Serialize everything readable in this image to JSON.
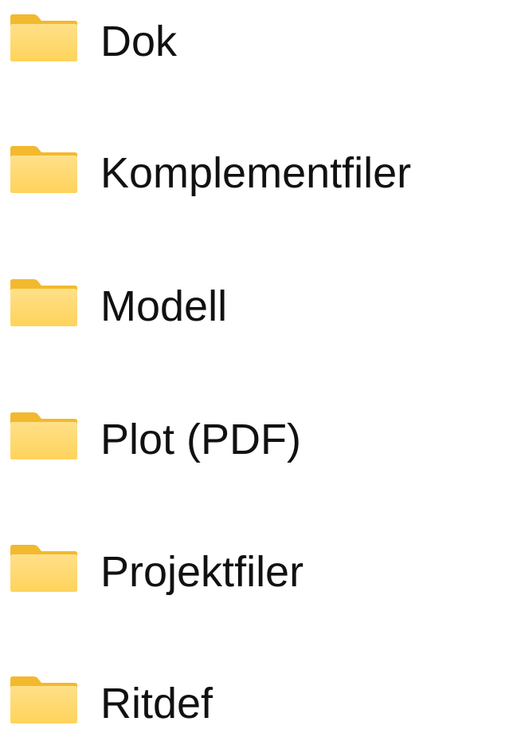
{
  "folder_list": {
    "items": [
      {
        "label": "Dok",
        "icon": "folder-icon"
      },
      {
        "label": "Komplementfiler",
        "icon": "folder-icon"
      },
      {
        "label": "Modell",
        "icon": "folder-icon"
      },
      {
        "label": "Plot (PDF)",
        "icon": "folder-icon"
      },
      {
        "label": "Projektfiler",
        "icon": "folder-icon"
      },
      {
        "label": "Ritdef",
        "icon": "folder-icon"
      }
    ]
  },
  "colors": {
    "folder_back": "#F2B92E",
    "folder_front": "#FFD767",
    "folder_front_light": "#FFE08A",
    "text": "#111111",
    "background": "#FFFFFF"
  }
}
